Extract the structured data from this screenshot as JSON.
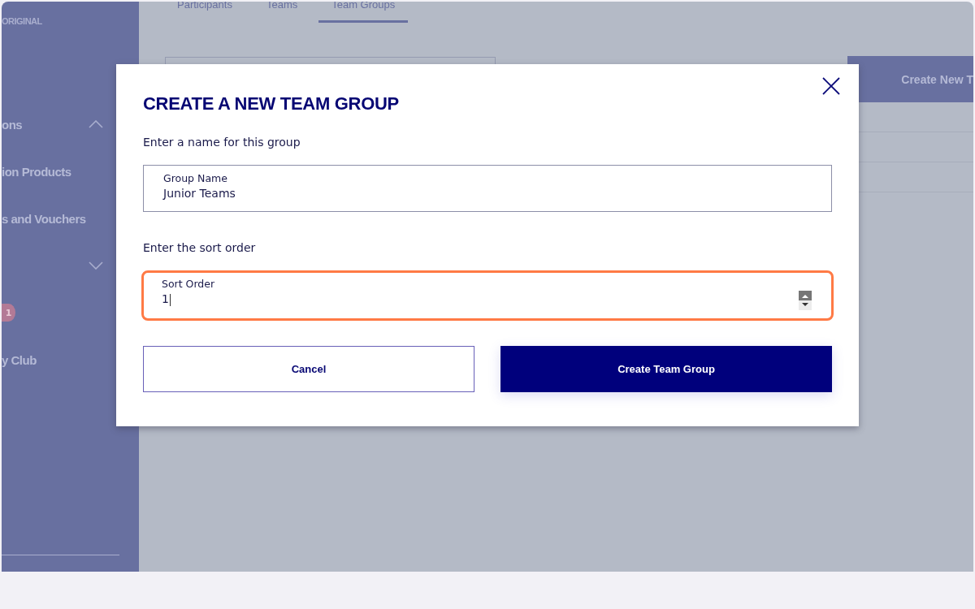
{
  "sidebar": {
    "brand": "ORIGINAL",
    "items": [
      {
        "label": "ons",
        "kind": "group",
        "expanded": true
      },
      {
        "label": "ion Products",
        "kind": "link"
      },
      {
        "label": "s and Vouchers",
        "kind": "link"
      },
      {
        "kind": "group",
        "expanded": false
      },
      {
        "label": "1",
        "kind": "badge"
      },
      {
        "label": "y Club",
        "kind": "link"
      }
    ]
  },
  "tabs": [
    {
      "label": "Participants",
      "selected": false
    },
    {
      "label": "Teams",
      "selected": false
    },
    {
      "label": "Team Groups",
      "selected": true
    }
  ],
  "create_button": "Create New T",
  "dialog": {
    "title": "CREATE A NEW TEAM GROUP",
    "name_prompt": "Enter a name for this group",
    "name_field": {
      "label": "Group Name",
      "value": "Junior Teams"
    },
    "sort_prompt": "Enter the sort order",
    "sort_field": {
      "label": "Sort Order",
      "value": "1",
      "highlighted": true
    },
    "cancel": "Cancel",
    "submit": "Create Team Group"
  }
}
